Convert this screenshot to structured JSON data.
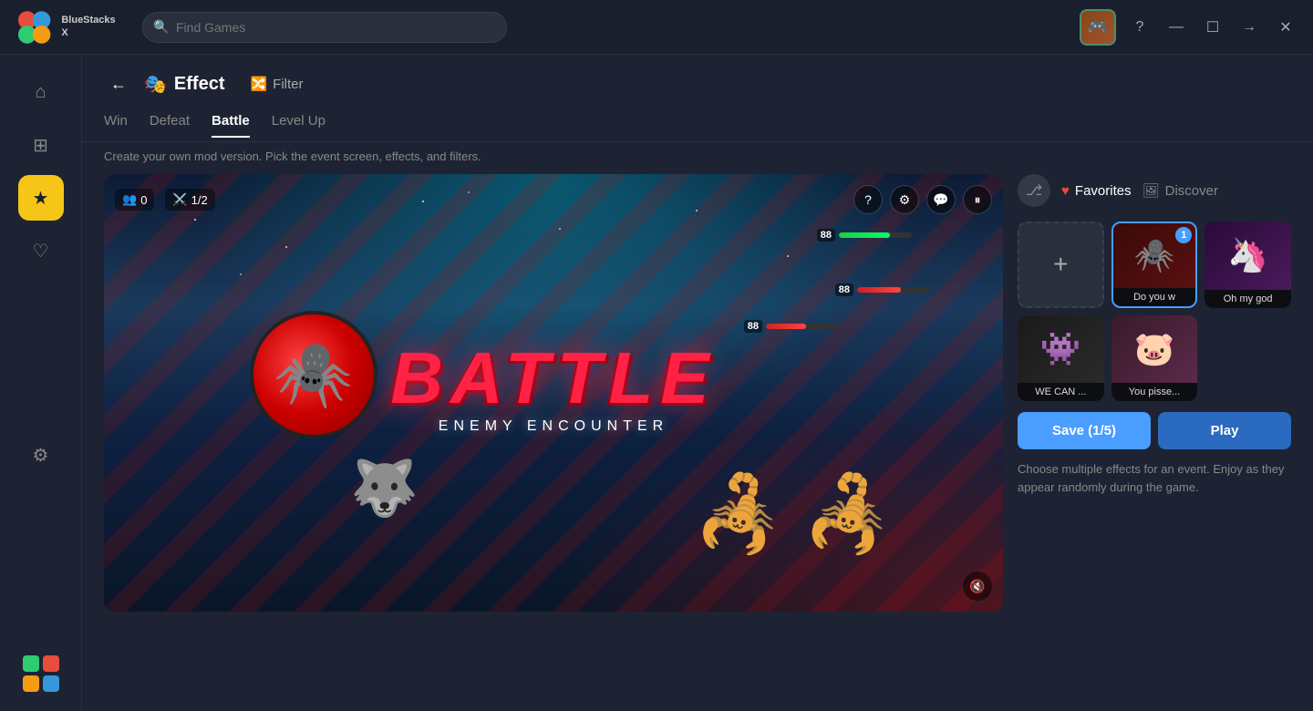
{
  "app": {
    "name": "BlueStacks X",
    "search_placeholder": "Find Games"
  },
  "titlebar": {
    "minimize": "—",
    "maximize": "☐",
    "forward": "→",
    "close": "✕",
    "help": "?"
  },
  "sidebar": {
    "items": [
      {
        "id": "home",
        "icon": "⌂",
        "label": "Home"
      },
      {
        "id": "apps",
        "icon": "⊞",
        "label": "Apps"
      },
      {
        "id": "effects",
        "icon": "★",
        "label": "Effects",
        "active": true
      },
      {
        "id": "favorites",
        "icon": "♡",
        "label": "Favorites"
      },
      {
        "id": "settings",
        "icon": "⚙",
        "label": "Settings"
      }
    ]
  },
  "header": {
    "back_label": "←",
    "title": "Effect",
    "filter_label": "Filter"
  },
  "tabs": [
    {
      "id": "win",
      "label": "Win"
    },
    {
      "id": "defeat",
      "label": "Defeat"
    },
    {
      "id": "battle",
      "label": "Battle",
      "active": true
    },
    {
      "id": "level_up",
      "label": "Level Up"
    }
  ],
  "subtitle": "Create your own mod version. Pick the event screen, effects, and filters.",
  "game_preview": {
    "battle_text": "BATTLE",
    "enemy_encounter": "ENEMY ENCOUNTER",
    "hud": {
      "users": "0",
      "swords": "1/2"
    }
  },
  "right_panel": {
    "favorites_label": "Favorites",
    "discover_label": "Discover",
    "thumbnails": [
      {
        "id": "add",
        "type": "add",
        "icon": "+"
      },
      {
        "id": "do-you-w",
        "label": "Do you w",
        "type": "image",
        "bg": "red-bg",
        "selected": true,
        "badge": "1",
        "emoji": "🕷️"
      },
      {
        "id": "oh-my-god",
        "label": "Oh my god",
        "type": "image",
        "bg": "purple-bg",
        "emoji": "🦄"
      },
      {
        "id": "we-can",
        "label": "WE CAN ...",
        "type": "image",
        "bg": "dark-bg",
        "emoji": "👾"
      },
      {
        "id": "you-pisse",
        "label": "You pisse...",
        "type": "image",
        "bg": "pink-bg",
        "emoji": "🐷"
      }
    ],
    "save_label": "Save (1/5)",
    "play_label": "Play",
    "description": "Choose multiple effects for an event. Enjoy as they appear randomly during the game."
  }
}
